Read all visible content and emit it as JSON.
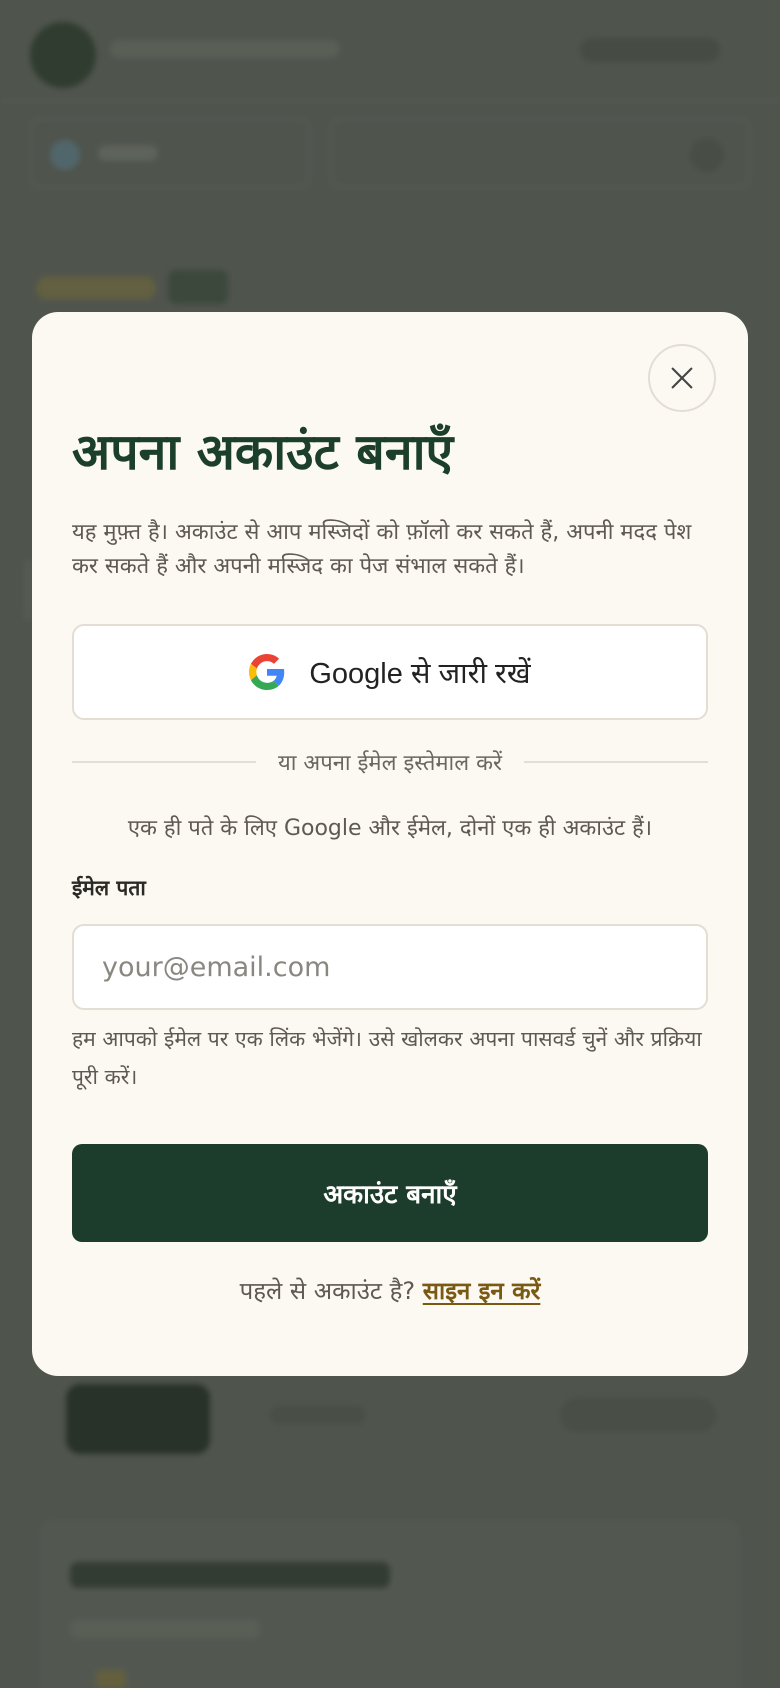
{
  "modal": {
    "title": "अपना अकाउंट बनाएँ",
    "subtitle": "यह मुफ़्त है। अकाउंट से आप मस्जिदों को फ़ॉलो कर सकते हैं, अपनी मदद पेश कर सकते हैं और अपनी मस्जिद का पेज संभाल सकते हैं।",
    "close_icon": "close-icon",
    "google_button_label": "Google से जारी रखें",
    "google_icon": "google-logo-icon",
    "divider_text": "या अपना ईमेल इस्तेमाल करें",
    "info_note": "एक ही पते के लिए Google और ईमेल, दोनों एक ही अकाउंट हैं।",
    "email_label": "ईमेल पता",
    "email_placeholder": "your@email.com",
    "email_value": "",
    "hint": "हम आपको ईमेल पर एक लिंक भेजेंगे। उसे खोलकर अपना पासवर्ड चुनें और प्रक्रिया पूरी करें।",
    "create_button_label": "अकाउंट बनाएँ",
    "signin_prompt": "पहले से अकाउंट है?",
    "signin_link": "साइन इन करें"
  },
  "colors": {
    "brand_green": "#1c3d2b",
    "title_green": "#1b3f2a",
    "link_gold": "#7a5a12",
    "modal_bg": "#fcf9f3"
  }
}
